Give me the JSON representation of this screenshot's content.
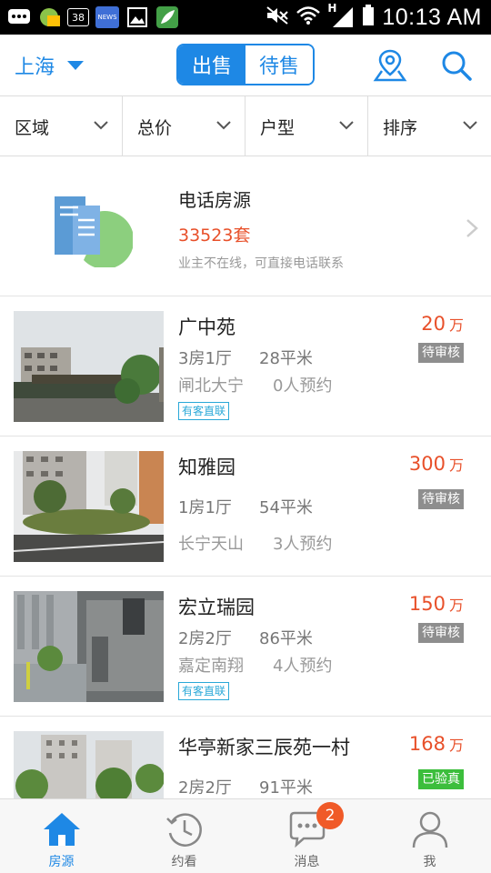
{
  "status_bar": {
    "time": "10:13 AM",
    "notification_count": "38",
    "news_label": "NEWS",
    "network_label": "H"
  },
  "header": {
    "city": "上海",
    "tabs": [
      {
        "label": "出售",
        "active": true
      },
      {
        "label": "待售",
        "active": false
      }
    ]
  },
  "filters": [
    {
      "label": "区域"
    },
    {
      "label": "总价"
    },
    {
      "label": "户型"
    },
    {
      "label": "排序"
    }
  ],
  "phone_source": {
    "title": "电话房源",
    "count": "33523套",
    "description": "业主不在线，可直接电话联系"
  },
  "listings": [
    {
      "name": "广中苑",
      "rooms": "3房1厅",
      "area": "28平米",
      "district": "闸北大宁",
      "appointments": "0人预约",
      "tag": "有客直联",
      "price": "20",
      "unit": "万",
      "status": "待审核",
      "status_type": "pending"
    },
    {
      "name": "知雅园",
      "rooms": "1房1厅",
      "area": "54平米",
      "district": "长宁天山",
      "appointments": "3人预约",
      "tag": "",
      "price": "300",
      "unit": "万",
      "status": "待审核",
      "status_type": "pending"
    },
    {
      "name": "宏立瑞园",
      "rooms": "2房2厅",
      "area": "86平米",
      "district": "嘉定南翔",
      "appointments": "4人预约",
      "tag": "有客直联",
      "price": "150",
      "unit": "万",
      "status": "待审核",
      "status_type": "pending"
    },
    {
      "name": "华亭新家三辰苑一村",
      "rooms": "2房2厅",
      "area": "91平米",
      "district": "",
      "appointments": "",
      "tag": "",
      "price": "168",
      "unit": "万",
      "status": "已验真",
      "status_type": "verified"
    }
  ],
  "bottom_nav": [
    {
      "label": "房源",
      "icon": "home-icon",
      "active": true
    },
    {
      "label": "约看",
      "icon": "history-clock-icon",
      "active": false
    },
    {
      "label": "消息",
      "icon": "chat-bubble-icon",
      "active": false,
      "badge": "2"
    },
    {
      "label": "我",
      "icon": "person-icon",
      "active": false
    }
  ],
  "colors": {
    "accent": "#1e88e5",
    "price": "#e8502a",
    "pending_badge": "#8e8e8e",
    "verified_badge": "#3cbe3c",
    "tag": "#29a8d8",
    "notification_badge": "#f05a28"
  }
}
